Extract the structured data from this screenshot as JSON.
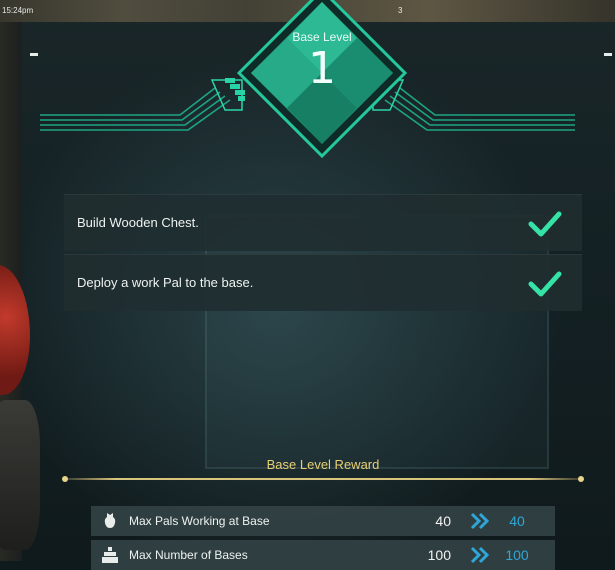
{
  "hud": {
    "time": "15:24pm",
    "counter": "3"
  },
  "base_level": {
    "label": "Base Level",
    "value": "1"
  },
  "tasks": [
    {
      "label": "Build Wooden Chest.",
      "completed": true
    },
    {
      "label": "Deploy a work Pal to the base.",
      "completed": true
    }
  ],
  "reward": {
    "title": "Base Level Reward",
    "rows": [
      {
        "icon": "pal-icon",
        "label": "Max Pals Working at Base",
        "old": "40",
        "new": "40"
      },
      {
        "icon": "base-icon",
        "label": "Max Number of Bases",
        "old": "100",
        "new": "100"
      }
    ]
  },
  "colors": {
    "accent_teal": "#2bbf9a",
    "check_green": "#36e3a7",
    "reward_gold": "#e7cf74",
    "new_value_blue": "#2ea6d8"
  }
}
